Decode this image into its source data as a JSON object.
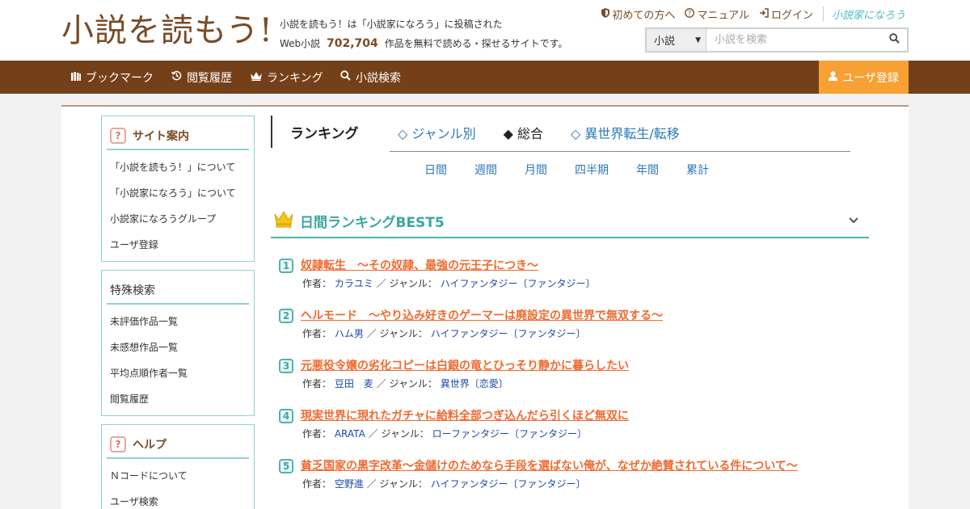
{
  "header": {
    "logo": "小説を読もう!",
    "tagline_line1": "小説を読もう！は「小説家になろう」に投稿された",
    "tagline_prefix": "Web小説",
    "work_count": "702,704",
    "tagline_suffix": "作品を無料で読める・探せるサイトです。",
    "top_links": [
      {
        "icon": "shield-icon",
        "label": "初めての方へ"
      },
      {
        "icon": "question-icon",
        "label": "マニュアル"
      },
      {
        "icon": "login-icon",
        "label": "ログイン"
      }
    ],
    "partner_logo": "小説家になろう",
    "search": {
      "category": "小説",
      "placeholder": "小説を検索"
    }
  },
  "nav": {
    "items": [
      {
        "icon": "bookmark-icon",
        "label": "ブックマーク"
      },
      {
        "icon": "history-icon",
        "label": "閲覧履歴"
      },
      {
        "icon": "crown-icon",
        "label": "ランキング"
      },
      {
        "icon": "search-icon",
        "label": "小説検索"
      }
    ],
    "register": "ユーザ登録"
  },
  "sidebar": {
    "site_guide": {
      "title": "サイト案内",
      "items": [
        "「小説を読もう！」について",
        "「小説家になろう」について",
        "小説家になろうグループ",
        "ユーザ登録"
      ]
    },
    "special_search": {
      "title": "特殊検索",
      "items": [
        "未評価作品一覧",
        "未感想作品一覧",
        "平均点順作者一覧",
        "閲覧履歴"
      ]
    },
    "help": {
      "title": "ヘルプ",
      "items": [
        "Ｎコードについて",
        "ユーザ検索"
      ]
    }
  },
  "ranking": {
    "heading": "ランキング",
    "genre_tabs": [
      {
        "label": "◇ ジャンル別",
        "active": false
      },
      {
        "label": "◆ 総合",
        "active": true
      },
      {
        "label": "◇ 異世界転生/転移",
        "active": false
      }
    ],
    "period_tabs": [
      "日間",
      "週間",
      "月間",
      "四半期",
      "年間",
      "累計"
    ],
    "best_title": "日間ランキングBEST5",
    "author_label": "作者：",
    "genre_label": "／ ジャンル：",
    "entries": [
      {
        "rank": "1",
        "title": "奴隷転生　～その奴隷、最強の元王子につき～",
        "author": "カラユミ",
        "genre": "ハイファンタジー〔ファンタジー〕"
      },
      {
        "rank": "2",
        "title": "ヘルモード　～やり込み好きのゲーマーは廃設定の異世界で無双する～",
        "author": "ハム男",
        "genre": "ハイファンタジー〔ファンタジー〕"
      },
      {
        "rank": "3",
        "title": "元悪役令嬢の劣化コピーは白銀の竜とひっそり静かに暮らしたい",
        "author": "豆田　麦",
        "genre": "異世界〔恋愛〕"
      },
      {
        "rank": "4",
        "title": "現実世界に現れたガチャに給料全部つぎ込んだら引くほど無双に",
        "author": "ARATA",
        "genre": "ローファンタジー〔ファンタジー〕"
      },
      {
        "rank": "5",
        "title": "貧乏国家の黒字改革〜金儲けのためなら手段を選ばない俺が、なぜか絶賛されている件について〜",
        "author": "空野進",
        "genre": "ハイファンタジー〔ファンタジー〕"
      }
    ]
  },
  "colors": {
    "brand_brown": "#74401a",
    "accent_orange": "#f7a033",
    "teal": "#4bb6a9",
    "title_orange": "#f06a2f",
    "link_blue": "#2a7ab8"
  }
}
